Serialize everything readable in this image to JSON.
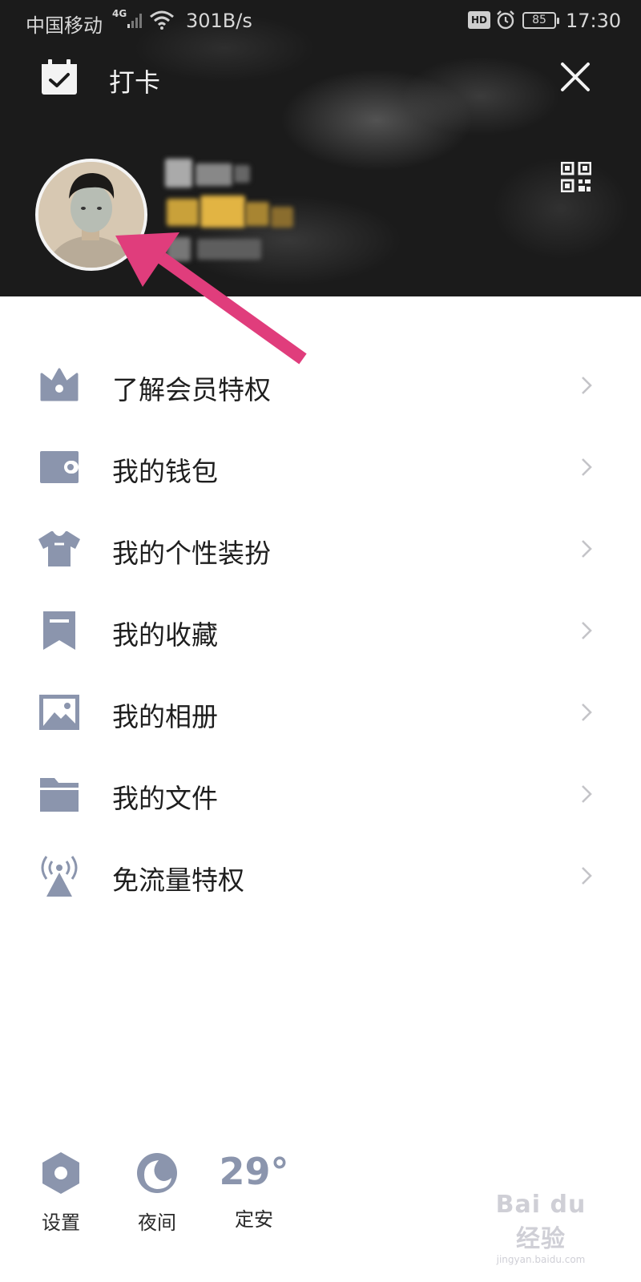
{
  "status_bar": {
    "carrier": "中国移动",
    "network": "4G",
    "speed": "301B/s",
    "hd_label": "HD",
    "battery": "85",
    "time": "17:30"
  },
  "header": {
    "checkin_label": "打卡",
    "checkin_icon": "calendar-check-icon",
    "close_icon": "close-icon",
    "qr_icon": "qr-code-icon"
  },
  "colors": {
    "accent_icon": "#8b95ad",
    "arrow": "#e03d7c",
    "header_bg": "#1b1b1b"
  },
  "menu": {
    "items": [
      {
        "label": "了解会员特权",
        "icon": "crown-icon"
      },
      {
        "label": "我的钱包",
        "icon": "wallet-icon"
      },
      {
        "label": "我的个性装扮",
        "icon": "shirt-icon"
      },
      {
        "label": "我的收藏",
        "icon": "bookmark-icon"
      },
      {
        "label": "我的相册",
        "icon": "photo-icon"
      },
      {
        "label": "我的文件",
        "icon": "folder-icon"
      },
      {
        "label": "免流量特权",
        "icon": "signal-tower-icon"
      }
    ]
  },
  "bottom": {
    "settings_label": "设置",
    "night_label": "夜间",
    "weather_temp": "29°",
    "weather_city": "定安"
  },
  "watermark": {
    "main": "Bai du 经验",
    "sub": "jingyan.baidu.com"
  }
}
